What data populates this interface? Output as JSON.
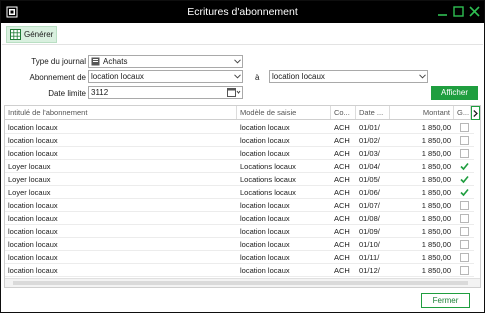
{
  "window": {
    "title": "Ecritures d'abonnement"
  },
  "toolbar": {
    "generate_label": "Générer"
  },
  "form": {
    "journal_type_label": "Type du journal",
    "journal_type_value": "Achats",
    "subscription_from_label": "Abonnement de",
    "subscription_from_value": "location locaux",
    "subscription_to_label": "à",
    "subscription_to_value": "location locaux",
    "date_limit_label": "Date limite",
    "date_limit_value": "3112",
    "show_label": "Afficher"
  },
  "table": {
    "columns": [
      "Intitulé de l'abonnement",
      "Modèle de saisie",
      "Co...",
      "Date ...",
      "Montant",
      "G..."
    ],
    "rows": [
      {
        "title": "location locaux",
        "model": "location locaux",
        "code": "ACH",
        "date": "01/01/",
        "amount": "1 850,00",
        "generated": false
      },
      {
        "title": "location locaux",
        "model": "location locaux",
        "code": "ACH",
        "date": "01/02/",
        "amount": "1 850,00",
        "generated": false
      },
      {
        "title": "location locaux",
        "model": "location locaux",
        "code": "ACH",
        "date": "01/03/",
        "amount": "1 850,00",
        "generated": false
      },
      {
        "title": "Loyer locaux",
        "model": "Locations locaux",
        "code": "ACH",
        "date": "01/04/",
        "amount": "1 850,00",
        "generated": true
      },
      {
        "title": "Loyer locaux",
        "model": "Locations locaux",
        "code": "ACH",
        "date": "01/05/",
        "amount": "1 850,00",
        "generated": true
      },
      {
        "title": "Loyer locaux",
        "model": "Locations locaux",
        "code": "ACH",
        "date": "01/06/",
        "amount": "1 850,00",
        "generated": true
      },
      {
        "title": "location locaux",
        "model": "location locaux",
        "code": "ACH",
        "date": "01/07/",
        "amount": "1 850,00",
        "generated": false
      },
      {
        "title": "location locaux",
        "model": "location locaux",
        "code": "ACH",
        "date": "01/08/",
        "amount": "1 850,00",
        "generated": false
      },
      {
        "title": "location locaux",
        "model": "location locaux",
        "code": "ACH",
        "date": "01/09/",
        "amount": "1 850,00",
        "generated": false
      },
      {
        "title": "location locaux",
        "model": "location locaux",
        "code": "ACH",
        "date": "01/10/",
        "amount": "1 850,00",
        "generated": false
      },
      {
        "title": "location locaux",
        "model": "location locaux",
        "code": "ACH",
        "date": "01/11/",
        "amount": "1 850,00",
        "generated": false
      },
      {
        "title": "location locaux",
        "model": "location locaux",
        "code": "ACH",
        "date": "01/12/",
        "amount": "1 850,00",
        "generated": false
      }
    ]
  },
  "footer": {
    "close_label": "Fermer"
  },
  "colors": {
    "accent": "#1f9e3f",
    "accent_light": "#d9f0df",
    "titlebar": "#000000"
  },
  "icons": {
    "app": "app-icon",
    "minimize": "minimize-icon",
    "maximize": "maximize-icon",
    "close": "close-icon",
    "generate": "grid-icon",
    "journal": "book-icon",
    "calendar": "calendar-icon",
    "scroll_right": "chevron-right-icon",
    "check": "check-icon"
  }
}
